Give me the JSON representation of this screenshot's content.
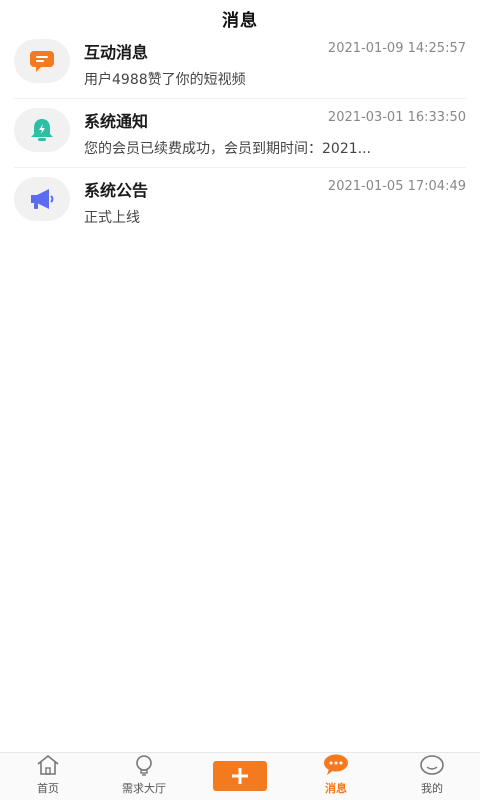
{
  "header": {
    "title": "消息"
  },
  "messages": [
    {
      "title": "互动消息",
      "time": "2021-01-09 14:25:57",
      "preview": "用户4988赞了你的短视频",
      "icon": "chat-bubble-icon",
      "icon_color": "#f47a20"
    },
    {
      "title": "系统通知",
      "time": "2021-03-01 16:33:50",
      "preview": "您的会员已续费成功，会员到期时间：2021...",
      "icon": "bell-icon",
      "icon_color": "#2bbfa6"
    },
    {
      "title": "系统公告",
      "time": "2021-01-05 17:04:49",
      "preview": "正式上线",
      "icon": "megaphone-icon",
      "icon_color": "#5b6cf0"
    }
  ],
  "tabbar": {
    "items": [
      {
        "label": "首页",
        "icon": "home-icon"
      },
      {
        "label": "需求大厅",
        "icon": "lightbulb-icon"
      },
      {
        "label": "",
        "icon": "plus-icon"
      },
      {
        "label": "消息",
        "icon": "chat-icon",
        "active": true
      },
      {
        "label": "我的",
        "icon": "profile-icon"
      }
    ],
    "accent_color": "#f47a20"
  }
}
